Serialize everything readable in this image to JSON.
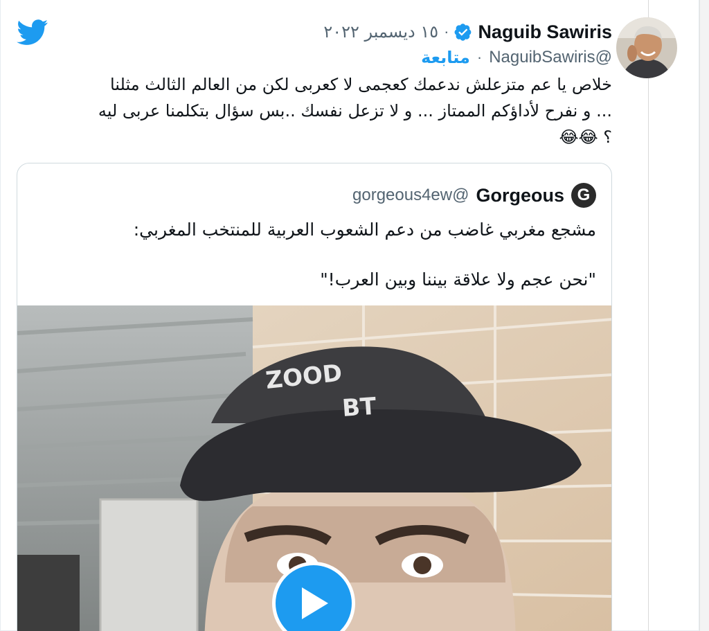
{
  "tweet": {
    "author_name": "Naguib Sawiris",
    "handle": "@NaguibSawiris",
    "date": "١٥ ديسمبر ٢٠٢٢",
    "separator": "·",
    "follow_label": "متابعة",
    "text_lines": [
      "خلاص يا عم متزعلش ندعمك كعجمى  لا كعربى لكن من العالم الثالث مثلنا",
      "... و نفرح لأداؤكم الممتاز ... و لا تزعل نفسك ..بس سؤال بتكلمنا عربى ليه",
      "؟ 😂😂"
    ]
  },
  "quote": {
    "avatar_letter": "G",
    "author_name": "Gorgeous",
    "handle": "@gorgeous4ew",
    "text_line_1": "مشجع مغربي غاضب من دعم الشعوب العربية للمنتخب المغربي:",
    "text_line_2": "\"نحن عجم ولا علاقة بيننا وبين العرب!\"",
    "video": {
      "play_progress": 0
    }
  },
  "icons": {
    "logo": "twitter-bird-icon",
    "verified": "verified-badge-icon",
    "play": "play-icon"
  },
  "colors": {
    "brand_blue": "#1d9bf0",
    "text_primary": "#0f1419",
    "text_secondary": "#536471",
    "border": "#cfd9de"
  }
}
